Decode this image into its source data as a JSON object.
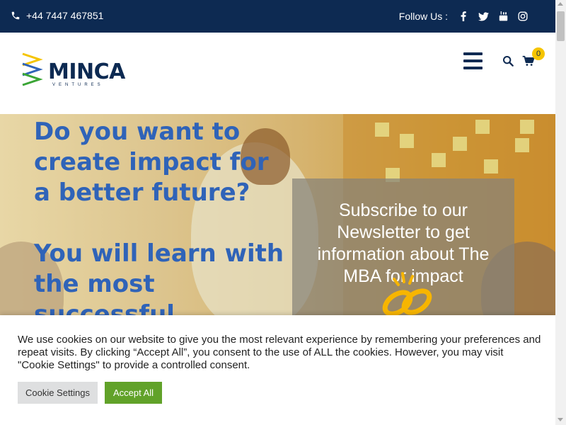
{
  "topbar": {
    "phone": "+44 7447 467851",
    "phone_icon": "phone-icon",
    "follow_label": "Follow Us :",
    "social": [
      "facebook-icon",
      "twitter-icon",
      "youtube-icon",
      "instagram-icon"
    ]
  },
  "header": {
    "logo_text": "MINCA",
    "logo_sub": "VENTURES",
    "cart_count": "0"
  },
  "hero": {
    "heading": "Do you want to create impact for a better future?",
    "heading2": "You will learn with the most successful",
    "subscribe": "Subscribe to our Newsletter to get information about The MBA for impact"
  },
  "cookie": {
    "text": "We use cookies on our website to give you the most relevant experience by remembering your preferences and repeat visits. By clicking “Accept All”, you consent to the use of ALL the cookies. However, you may visit \"Cookie Settings\" to provide a controlled consent.",
    "settings_label": "Cookie Settings",
    "accept_label": "Accept All"
  },
  "colors": {
    "navy": "#0d2a52",
    "hero_blue": "#2f63b8",
    "accept_green": "#61a229",
    "badge_yellow": "#f5c400"
  }
}
